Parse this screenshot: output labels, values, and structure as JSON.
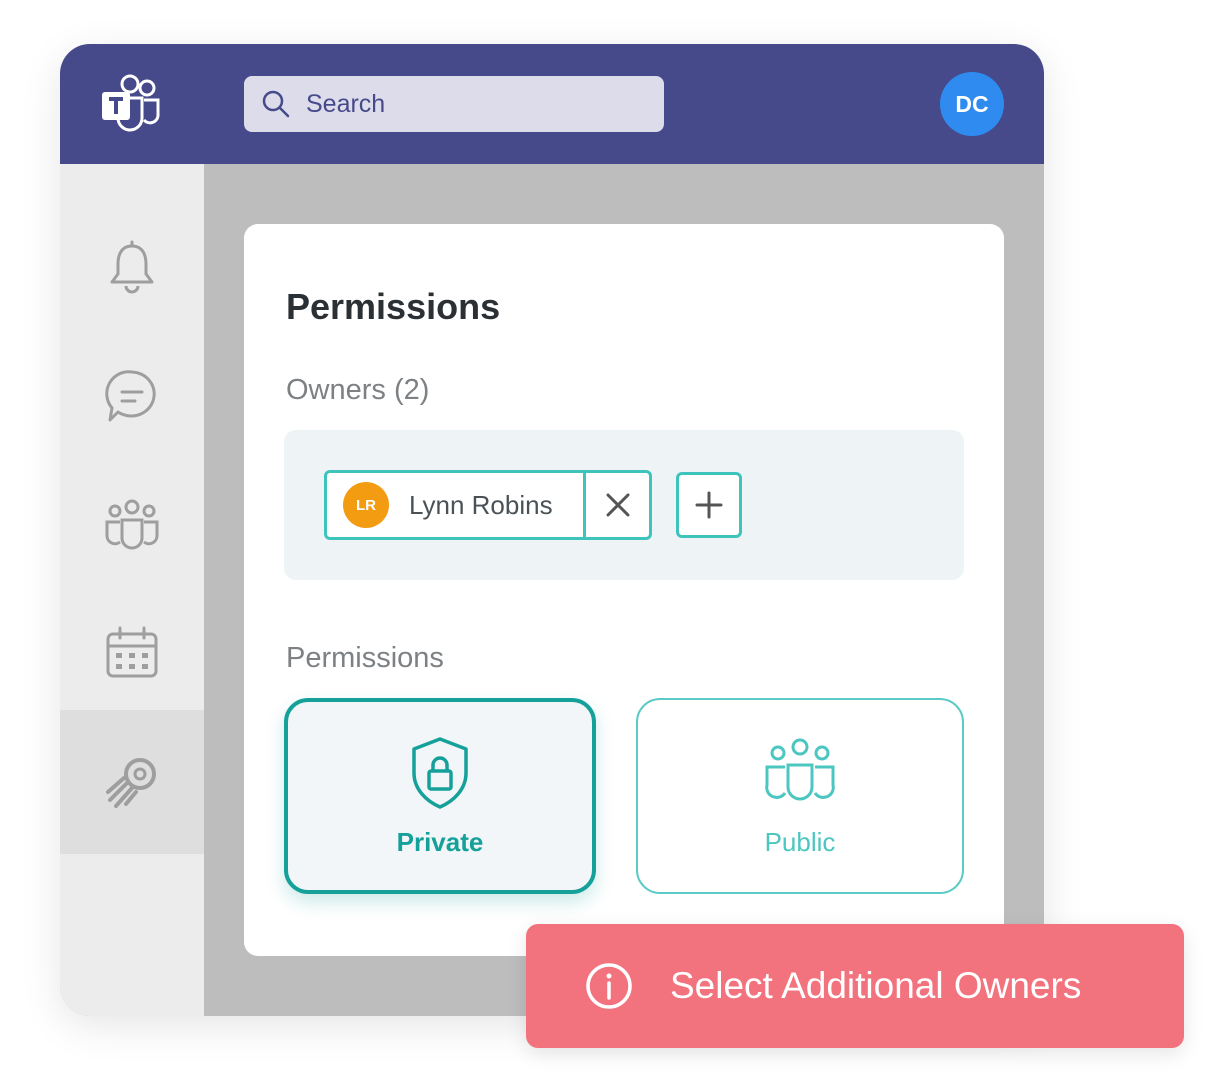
{
  "header": {
    "app_icon": "teams-logo-icon",
    "search": {
      "icon": "search-icon",
      "placeholder": "Search"
    },
    "user_avatar": {
      "initials": "DC",
      "color": "#2f8bf0"
    }
  },
  "sidebar": {
    "items": [
      {
        "icon": "bell-icon"
      },
      {
        "icon": "chat-icon"
      },
      {
        "icon": "teams-icon"
      },
      {
        "icon": "calendar-icon"
      },
      {
        "icon": "app-logo-icon",
        "active": true
      }
    ]
  },
  "card": {
    "title": "Permissions",
    "owners": {
      "label": "Owners (2)",
      "chips": [
        {
          "initials": "LR",
          "name": "Lynn Robins",
          "avatar_color": "#f39c12"
        }
      ],
      "remove_icon": "close-icon",
      "add_icon": "plus-icon"
    },
    "permissions": {
      "label": "Permissions",
      "options": [
        {
          "label": "Private",
          "icon": "shield-lock-icon",
          "selected": true
        },
        {
          "label": "Public",
          "icon": "group-icon",
          "selected": false
        }
      ]
    }
  },
  "toast": {
    "icon": "info-icon",
    "message": "Select Additional Owners",
    "color": "#f2737e"
  },
  "colors": {
    "header": "#464a8b",
    "accent": "#15a19a",
    "accent_light": "#3fc3bd"
  }
}
